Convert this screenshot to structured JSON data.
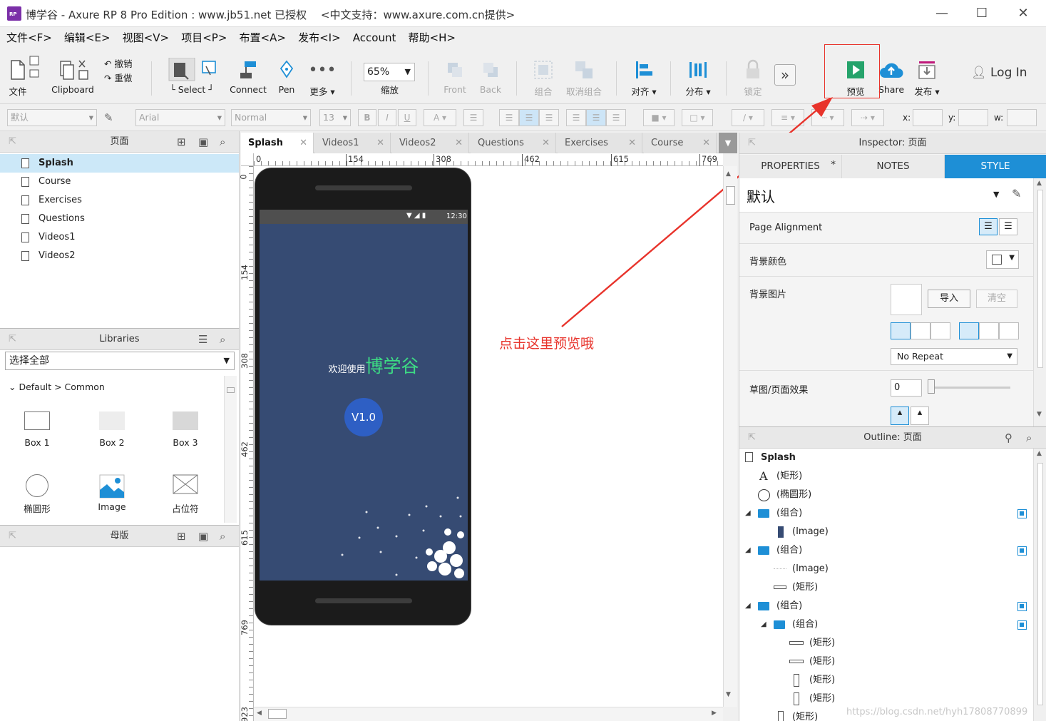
{
  "window": {
    "title": "博学谷 - Axure RP 8 Pro Edition : www.jb51.net 已授权　 <中文支持：www.axure.com.cn提供>",
    "minimize": "—",
    "maximize": "☐",
    "close": "✕"
  },
  "menu": [
    "文件<F>",
    "编辑<E>",
    "视图<V>",
    "项目<P>",
    "布置<A>",
    "发布<I>",
    "Account",
    "帮助<H>"
  ],
  "toolbar": {
    "file": "文件",
    "clipboard": "Clipboard",
    "undo": "撤销",
    "redo": "重做",
    "select": "Select",
    "connect": "Connect",
    "pen": "Pen",
    "more": "更多 ▾",
    "zoom": "65%",
    "zoom_label": "缩放",
    "front": "Front",
    "back": "Back",
    "group": "组合",
    "ungroup": "取消组合",
    "align": "对齐 ▾",
    "distribute": "分布 ▾",
    "lock": "锁定",
    "preview": "预览",
    "share": "Share",
    "publish": "发布 ▾",
    "login": "Log In"
  },
  "format": {
    "style": "默认",
    "font": "Arial",
    "weight": "Normal",
    "size": "13",
    "x": "x:",
    "y": "y:",
    "w": "w:"
  },
  "pages": {
    "title": "页面",
    "items": [
      "Splash",
      "Course",
      "Exercises",
      "Questions",
      "Videos1",
      "Videos2"
    ],
    "selected": 0
  },
  "libraries": {
    "title": "Libraries",
    "select": "选择全部",
    "group": "Default > Common",
    "widgets": [
      "Box 1",
      "Box 2",
      "Box 3",
      "椭圆形",
      "Image",
      "占位符"
    ]
  },
  "masters": {
    "title": "母版"
  },
  "tabs": [
    "Splash",
    "Videos1",
    "Videos2",
    "Questions",
    "Exercises",
    "Course"
  ],
  "ruler": {
    "top": [
      "0",
      "154",
      "308",
      "462",
      "615",
      "769"
    ],
    "left": [
      "0",
      "154",
      "308",
      "462",
      "615",
      "769",
      "923"
    ]
  },
  "phone": {
    "time": "12:30",
    "welcome": "欢迎使用",
    "brand": "博学谷",
    "version": "V1.0"
  },
  "annotation": {
    "text": "点击这里预览哦",
    "color": "#e8332b"
  },
  "inspector": {
    "title": "Inspector: 页面",
    "tabs": [
      "PROPERTIES",
      "NOTES",
      "STYLE"
    ],
    "properties_marker": "*",
    "style_name": "默认",
    "page_alignment": "Page Alignment",
    "bg_color": "背景颜色",
    "bg_image": "背景图片",
    "import": "导入",
    "clear": "清空",
    "repeat": "No Repeat",
    "sketch": "草图/页面效果",
    "sketch_value": "0"
  },
  "outline": {
    "title": "Outline: 页面",
    "root": "Splash",
    "items": [
      "(矩形)",
      "(椭圆形)",
      "(组合)",
      "(Image)",
      "(组合)",
      "(Image)",
      "(矩形)",
      "(组合)",
      "(组合)",
      "(矩形)",
      "(矩形)",
      "(矩形)",
      "(矩形)",
      "(矩形)"
    ]
  },
  "watermark": "https://blog.csdn.net/hyh17808770899",
  "colors": {
    "accent": "#1e8fd6",
    "phone_screen": "#364b73",
    "brand_green": "#3ddc84",
    "version_btn": "#2e5fc4"
  }
}
